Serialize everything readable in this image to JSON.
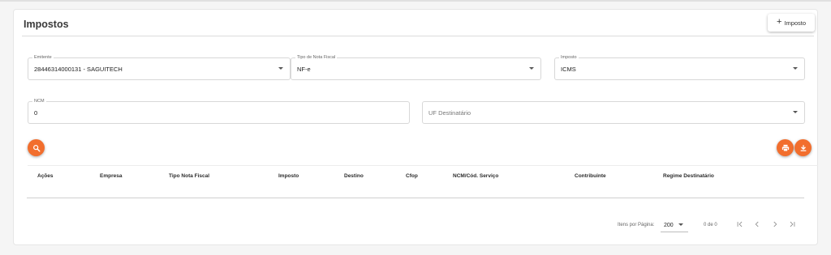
{
  "page": {
    "title": "Impostos",
    "add_button_label": "Imposto"
  },
  "filters": {
    "emitente": {
      "label": "Emitente",
      "value": "28446314000131 - SAGUITECH"
    },
    "tipo_nota": {
      "label": "Tipo de Nota Fiscal",
      "value": "NF-e"
    },
    "imposto": {
      "label": "Imposto",
      "value": "ICMS"
    },
    "ncm": {
      "label": "NCM",
      "value": "0"
    },
    "uf_destinatario": {
      "placeholder": "UF Destinatário"
    }
  },
  "actions": {
    "search_icon": "search-icon",
    "print_icon": "print-icon",
    "download_icon": "download-icon"
  },
  "table": {
    "columns": [
      "Ações",
      "Empresa",
      "Tipo Nota Fiscal",
      "Imposto",
      "Destino",
      "Cfop",
      "NCM/Cód. Serviço",
      "Contribuinte",
      "Regime Destinatário"
    ],
    "rows": []
  },
  "pagination": {
    "items_per_page_label": "Itens por Página:",
    "items_per_page_value": "200",
    "range_text": "0 de 0"
  },
  "colors": {
    "accent": "#f26e2d"
  }
}
